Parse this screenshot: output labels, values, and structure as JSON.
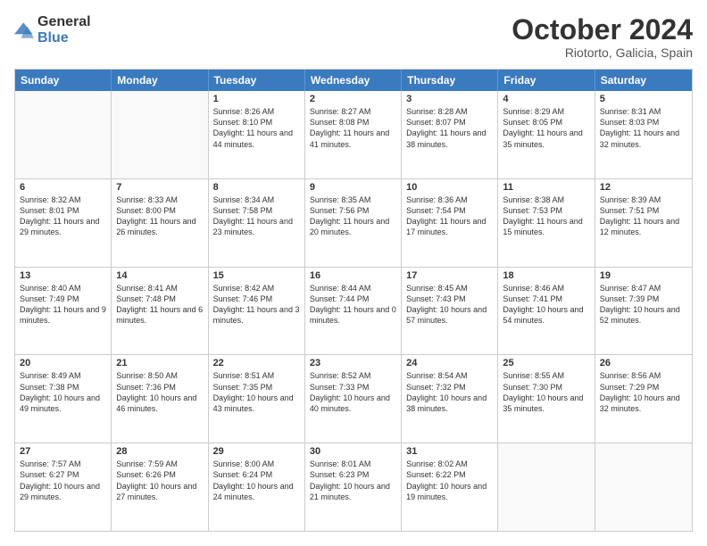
{
  "logo": {
    "line1": "General",
    "line2": "Blue"
  },
  "header": {
    "month": "October 2024",
    "location": "Riotorto, Galicia, Spain"
  },
  "weekdays": [
    "Sunday",
    "Monday",
    "Tuesday",
    "Wednesday",
    "Thursday",
    "Friday",
    "Saturday"
  ],
  "rows": [
    [
      {
        "day": "",
        "info": "",
        "empty": true
      },
      {
        "day": "",
        "info": "",
        "empty": true
      },
      {
        "day": "1",
        "info": "Sunrise: 8:26 AM\nSunset: 8:10 PM\nDaylight: 11 hours and 44 minutes."
      },
      {
        "day": "2",
        "info": "Sunrise: 8:27 AM\nSunset: 8:08 PM\nDaylight: 11 hours and 41 minutes."
      },
      {
        "day": "3",
        "info": "Sunrise: 8:28 AM\nSunset: 8:07 PM\nDaylight: 11 hours and 38 minutes."
      },
      {
        "day": "4",
        "info": "Sunrise: 8:29 AM\nSunset: 8:05 PM\nDaylight: 11 hours and 35 minutes."
      },
      {
        "day": "5",
        "info": "Sunrise: 8:31 AM\nSunset: 8:03 PM\nDaylight: 11 hours and 32 minutes."
      }
    ],
    [
      {
        "day": "6",
        "info": "Sunrise: 8:32 AM\nSunset: 8:01 PM\nDaylight: 11 hours and 29 minutes."
      },
      {
        "day": "7",
        "info": "Sunrise: 8:33 AM\nSunset: 8:00 PM\nDaylight: 11 hours and 26 minutes."
      },
      {
        "day": "8",
        "info": "Sunrise: 8:34 AM\nSunset: 7:58 PM\nDaylight: 11 hours and 23 minutes."
      },
      {
        "day": "9",
        "info": "Sunrise: 8:35 AM\nSunset: 7:56 PM\nDaylight: 11 hours and 20 minutes."
      },
      {
        "day": "10",
        "info": "Sunrise: 8:36 AM\nSunset: 7:54 PM\nDaylight: 11 hours and 17 minutes."
      },
      {
        "day": "11",
        "info": "Sunrise: 8:38 AM\nSunset: 7:53 PM\nDaylight: 11 hours and 15 minutes."
      },
      {
        "day": "12",
        "info": "Sunrise: 8:39 AM\nSunset: 7:51 PM\nDaylight: 11 hours and 12 minutes."
      }
    ],
    [
      {
        "day": "13",
        "info": "Sunrise: 8:40 AM\nSunset: 7:49 PM\nDaylight: 11 hours and 9 minutes."
      },
      {
        "day": "14",
        "info": "Sunrise: 8:41 AM\nSunset: 7:48 PM\nDaylight: 11 hours and 6 minutes."
      },
      {
        "day": "15",
        "info": "Sunrise: 8:42 AM\nSunset: 7:46 PM\nDaylight: 11 hours and 3 minutes."
      },
      {
        "day": "16",
        "info": "Sunrise: 8:44 AM\nSunset: 7:44 PM\nDaylight: 11 hours and 0 minutes."
      },
      {
        "day": "17",
        "info": "Sunrise: 8:45 AM\nSunset: 7:43 PM\nDaylight: 10 hours and 57 minutes."
      },
      {
        "day": "18",
        "info": "Sunrise: 8:46 AM\nSunset: 7:41 PM\nDaylight: 10 hours and 54 minutes."
      },
      {
        "day": "19",
        "info": "Sunrise: 8:47 AM\nSunset: 7:39 PM\nDaylight: 10 hours and 52 minutes."
      }
    ],
    [
      {
        "day": "20",
        "info": "Sunrise: 8:49 AM\nSunset: 7:38 PM\nDaylight: 10 hours and 49 minutes."
      },
      {
        "day": "21",
        "info": "Sunrise: 8:50 AM\nSunset: 7:36 PM\nDaylight: 10 hours and 46 minutes."
      },
      {
        "day": "22",
        "info": "Sunrise: 8:51 AM\nSunset: 7:35 PM\nDaylight: 10 hours and 43 minutes."
      },
      {
        "day": "23",
        "info": "Sunrise: 8:52 AM\nSunset: 7:33 PM\nDaylight: 10 hours and 40 minutes."
      },
      {
        "day": "24",
        "info": "Sunrise: 8:54 AM\nSunset: 7:32 PM\nDaylight: 10 hours and 38 minutes."
      },
      {
        "day": "25",
        "info": "Sunrise: 8:55 AM\nSunset: 7:30 PM\nDaylight: 10 hours and 35 minutes."
      },
      {
        "day": "26",
        "info": "Sunrise: 8:56 AM\nSunset: 7:29 PM\nDaylight: 10 hours and 32 minutes."
      }
    ],
    [
      {
        "day": "27",
        "info": "Sunrise: 7:57 AM\nSunset: 6:27 PM\nDaylight: 10 hours and 29 minutes."
      },
      {
        "day": "28",
        "info": "Sunrise: 7:59 AM\nSunset: 6:26 PM\nDaylight: 10 hours and 27 minutes."
      },
      {
        "day": "29",
        "info": "Sunrise: 8:00 AM\nSunset: 6:24 PM\nDaylight: 10 hours and 24 minutes."
      },
      {
        "day": "30",
        "info": "Sunrise: 8:01 AM\nSunset: 6:23 PM\nDaylight: 10 hours and 21 minutes."
      },
      {
        "day": "31",
        "info": "Sunrise: 8:02 AM\nSunset: 6:22 PM\nDaylight: 10 hours and 19 minutes."
      },
      {
        "day": "",
        "info": "",
        "empty": true
      },
      {
        "day": "",
        "info": "",
        "empty": true
      }
    ]
  ]
}
